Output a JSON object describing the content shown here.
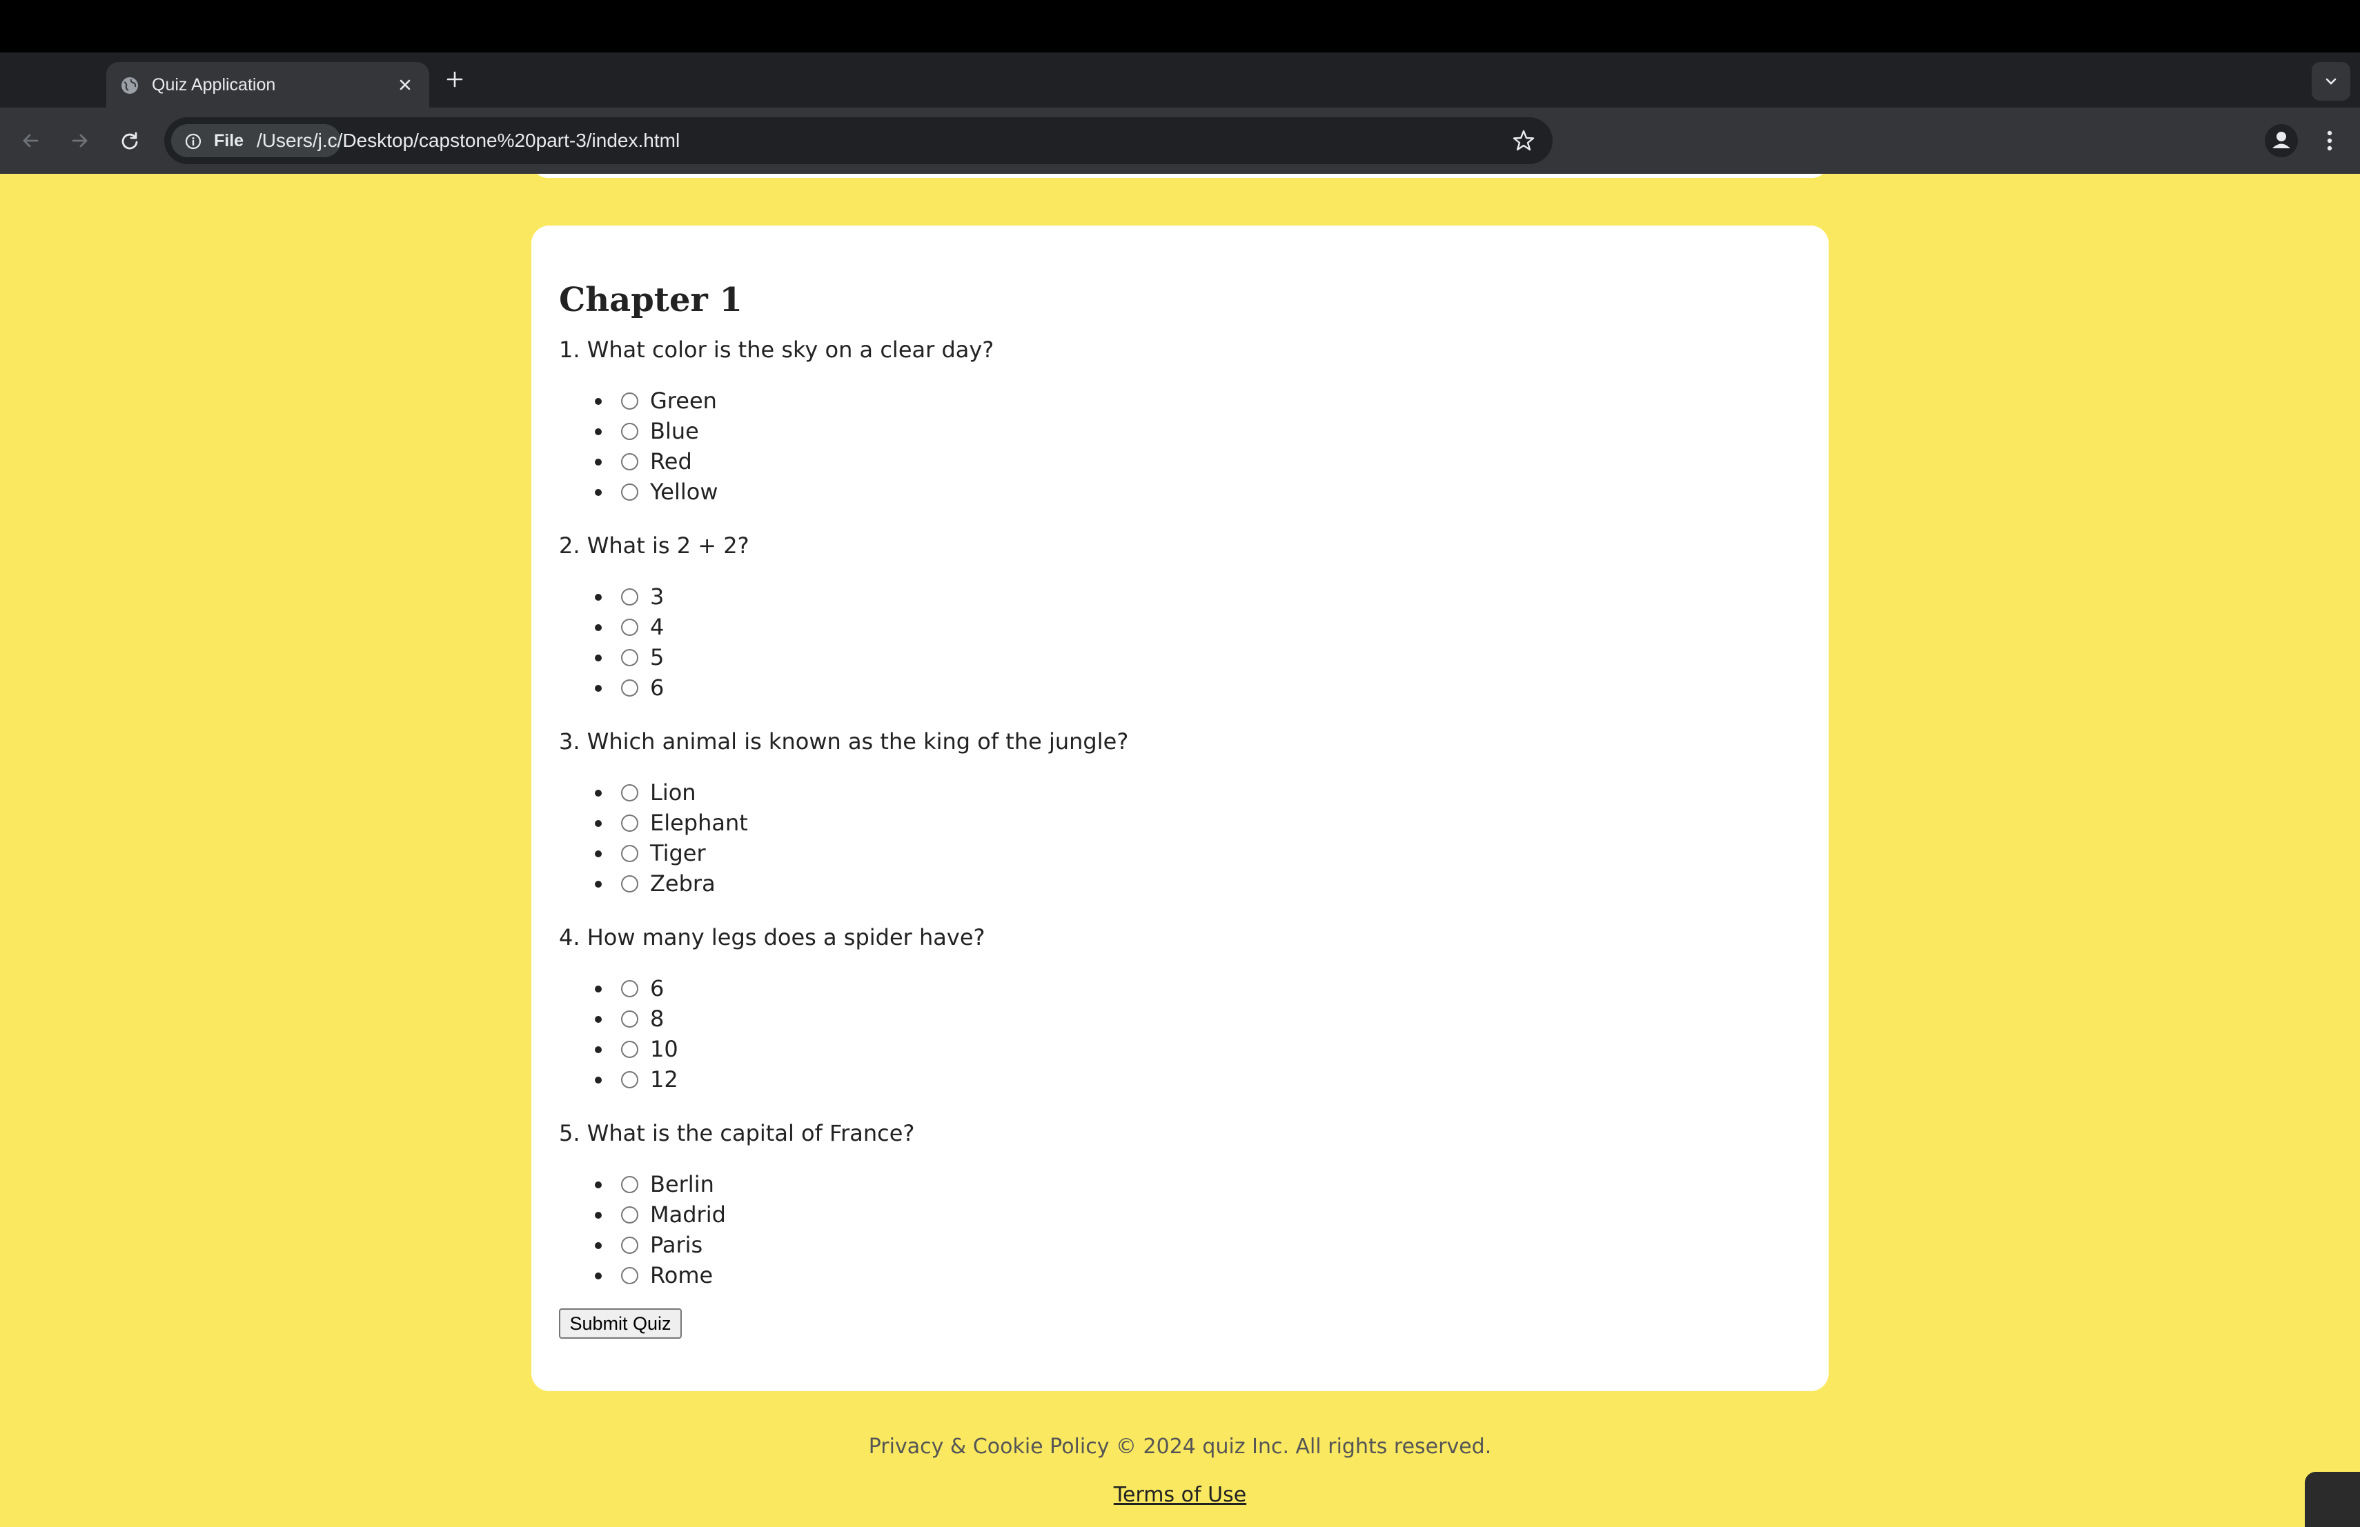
{
  "browser": {
    "tab_title": "Quiz Application",
    "url_chip": "File",
    "url": "/Users/j.c/Desktop/capstone%20part-3/index.html"
  },
  "quiz": {
    "chapter_title": "Chapter 1",
    "questions": [
      {
        "text": "1. What color is the sky on a clear day?",
        "options": [
          "Green",
          "Blue",
          "Red",
          "Yellow"
        ]
      },
      {
        "text": "2. What is 2 + 2?",
        "options": [
          "3",
          "4",
          "5",
          "6"
        ]
      },
      {
        "text": "3. Which animal is known as the king of the jungle?",
        "options": [
          "Lion",
          "Elephant",
          "Tiger",
          "Zebra"
        ]
      },
      {
        "text": "4. How many legs does a spider have?",
        "options": [
          "6",
          "8",
          "10",
          "12"
        ]
      },
      {
        "text": "5. What is the capital of France?",
        "options": [
          "Berlin",
          "Madrid",
          "Paris",
          "Rome"
        ]
      }
    ],
    "submit_label": "Submit Quiz"
  },
  "footer": {
    "copyright": "Privacy & Cookie Policy © 2024 quiz Inc. All rights reserved.",
    "terms_link": "Terms of Use"
  },
  "colors": {
    "page_background": "#fae960",
    "card_background": "#ffffff",
    "chrome_dark": "#202124",
    "chrome_toolbar": "#35363a"
  }
}
